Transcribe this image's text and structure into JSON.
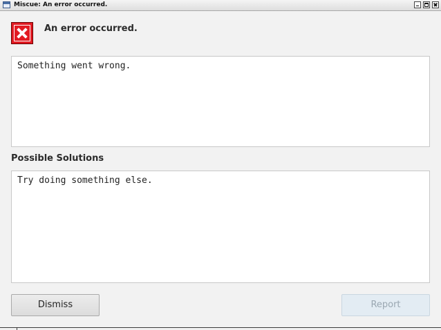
{
  "window": {
    "title": "Miscue: An error occurred."
  },
  "dialog": {
    "heading": "An error occurred.",
    "message": "Something went wrong.",
    "solutions_label": "Possible Solutions",
    "solutions": "Try doing something else."
  },
  "buttons": {
    "dismiss_label": "Dismiss",
    "report_label": "Report",
    "report_enabled": false
  },
  "colors": {
    "error_icon": "#e21b23",
    "window_bg": "#f2f2f2",
    "report_disabled_bg": "#e3ecf3"
  },
  "icons": {
    "app": "app-window-icon",
    "error": "error-x-icon"
  }
}
